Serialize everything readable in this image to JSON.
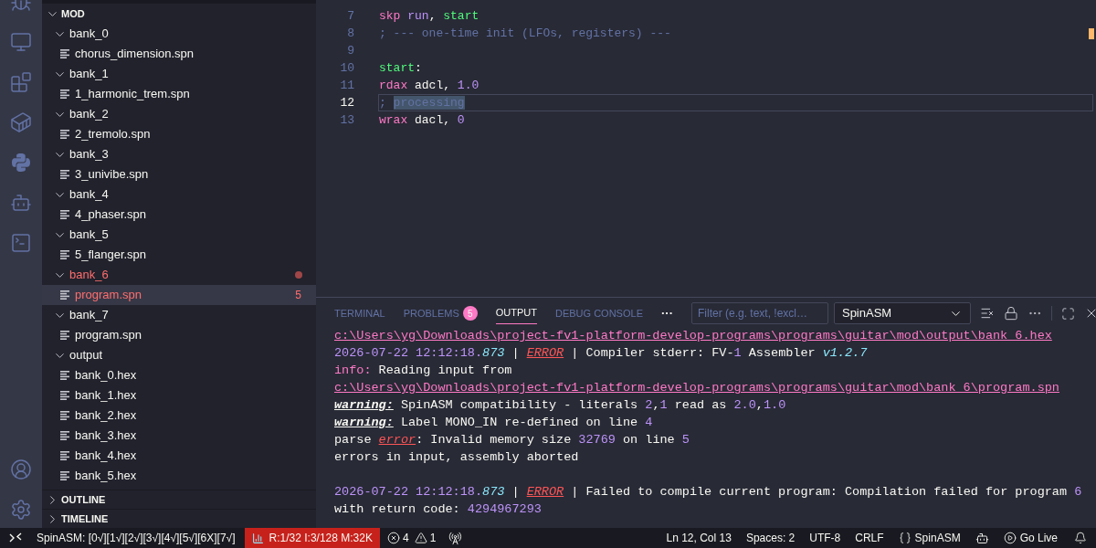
{
  "explorer": {
    "section": "MOD",
    "tree": [
      {
        "label": "bank_0",
        "expanded": true,
        "error": false,
        "selected": false,
        "children": [
          {
            "label": "chorus_dimension.spn",
            "error": false,
            "selected": false
          }
        ]
      },
      {
        "label": "bank_1",
        "expanded": true,
        "error": false,
        "selected": false,
        "children": [
          {
            "label": "1_harmonic_trem.spn",
            "error": false,
            "selected": false
          }
        ]
      },
      {
        "label": "bank_2",
        "expanded": true,
        "error": false,
        "selected": false,
        "children": [
          {
            "label": "2_tremolo.spn",
            "error": false,
            "selected": false
          }
        ]
      },
      {
        "label": "bank_3",
        "expanded": true,
        "error": false,
        "selected": false,
        "children": [
          {
            "label": "3_univibe.spn",
            "error": false,
            "selected": false
          }
        ]
      },
      {
        "label": "bank_4",
        "expanded": true,
        "error": false,
        "selected": false,
        "children": [
          {
            "label": "4_phaser.spn",
            "error": false,
            "selected": false
          }
        ]
      },
      {
        "label": "bank_5",
        "expanded": true,
        "error": false,
        "selected": false,
        "children": [
          {
            "label": "5_flanger.spn",
            "error": false,
            "selected": false
          }
        ]
      },
      {
        "label": "bank_6",
        "expanded": true,
        "error": true,
        "selected": false,
        "children": [
          {
            "label": "program.spn",
            "error": true,
            "selected": true,
            "badge": "5"
          }
        ]
      },
      {
        "label": "bank_7",
        "expanded": true,
        "error": false,
        "selected": false,
        "children": [
          {
            "label": "program.spn",
            "error": false,
            "selected": false
          }
        ]
      },
      {
        "label": "output",
        "expanded": true,
        "error": false,
        "selected": false,
        "children": [
          {
            "label": "bank_0.hex",
            "error": false,
            "selected": false
          },
          {
            "label": "bank_1.hex",
            "error": false,
            "selected": false
          },
          {
            "label": "bank_2.hex",
            "error": false,
            "selected": false
          },
          {
            "label": "bank_3.hex",
            "error": false,
            "selected": false
          },
          {
            "label": "bank_4.hex",
            "error": false,
            "selected": false
          },
          {
            "label": "bank_5.hex",
            "error": false,
            "selected": false
          }
        ]
      }
    ],
    "collapsed_sections": [
      "OUTLINE",
      "TIMELINE"
    ]
  },
  "editor": {
    "lines": [
      {
        "number": "7",
        "current": false,
        "tokens": [
          {
            "text": "skp",
            "kind": "keyword",
            "selected": false
          },
          {
            "text": " run",
            "kind": "variable",
            "selected": false
          },
          {
            "text": ", ",
            "kind": "plain",
            "selected": false
          },
          {
            "text": "start",
            "kind": "label",
            "selected": false
          }
        ]
      },
      {
        "number": "8",
        "current": false,
        "tokens": [
          {
            "text": "; --- one-time init (LFOs, registers) ---",
            "kind": "comment",
            "selected": false
          }
        ]
      },
      {
        "number": "9",
        "current": false
      },
      {
        "number": "10",
        "current": false,
        "tokens": [
          {
            "text": "start",
            "kind": "label",
            "selected": false
          },
          {
            "text": ":",
            "kind": "plain",
            "selected": false
          }
        ]
      },
      {
        "number": "11",
        "current": false,
        "tokens": [
          {
            "text": "rdax",
            "kind": "keyword",
            "selected": false
          },
          {
            "text": " adcl, ",
            "kind": "plain",
            "selected": false
          },
          {
            "text": "1.0",
            "kind": "number",
            "selected": false
          }
        ]
      },
      {
        "number": "12",
        "current": true,
        "tokens": [
          {
            "text": "; ",
            "kind": "comment",
            "selected": false
          },
          {
            "text": "processing",
            "kind": "comment",
            "selected": true
          }
        ]
      },
      {
        "number": "13",
        "current": false,
        "tokens": [
          {
            "text": "wrax",
            "kind": "keyword",
            "selected": false
          },
          {
            "text": " dacl, ",
            "kind": "plain",
            "selected": false
          },
          {
            "text": "0",
            "kind": "number",
            "selected": false
          }
        ]
      }
    ]
  },
  "panel": {
    "tabs": [
      {
        "label": "TERMINAL",
        "selected": false
      },
      {
        "label": "PROBLEMS",
        "badge": "5",
        "selected": false
      },
      {
        "label": "OUTPUT",
        "selected": true
      },
      {
        "label": "DEBUG CONSOLE",
        "selected": false
      }
    ],
    "more": "···",
    "filter": {
      "placeholder": "Filter (e.g. text, !excl…"
    },
    "channel": "SpinASM",
    "output": [
      {
        "space_before": false,
        "segments": [
          {
            "text": "c:\\Users\\yg\\Downloads\\project-fv1-platform-develop-programs\\programs\\guitar\\mod\\output\\bank_6.hex",
            "kind": "path"
          }
        ]
      },
      {
        "space_before": false,
        "segments": [
          {
            "text": "2026-07-22 12:12:18.",
            "kind": "timestamp"
          },
          {
            "text": "873",
            "kind": "ms"
          },
          {
            "text": " | ",
            "kind": "text"
          },
          {
            "text": "ERROR",
            "kind": "error_tag"
          },
          {
            "text": " | Compiler stderr: FV-",
            "kind": "text"
          },
          {
            "text": "1",
            "kind": "number"
          },
          {
            "text": " Assembler ",
            "kind": "text"
          },
          {
            "text": "v1.2.7",
            "kind": "ms"
          }
        ]
      },
      {
        "space_before": false,
        "segments": [
          {
            "text": "info:",
            "kind": "info"
          },
          {
            "text": " Reading input from",
            "kind": "text"
          }
        ]
      },
      {
        "space_before": false,
        "segments": [
          {
            "text": "c:\\Users\\yg\\Downloads\\project-fv1-platform-develop-programs\\programs\\guitar\\mod\\bank_6\\program.spn",
            "kind": "path"
          }
        ]
      },
      {
        "space_before": false,
        "segments": [
          {
            "text": "warning:",
            "kind": "warning"
          },
          {
            "text": " SpinASM compatibility - literals ",
            "kind": "text"
          },
          {
            "text": "2",
            "kind": "number"
          },
          {
            "text": ",",
            "kind": "text"
          },
          {
            "text": "1",
            "kind": "number"
          },
          {
            "text": " read as ",
            "kind": "text"
          },
          {
            "text": "2.0",
            "kind": "number"
          },
          {
            "text": ",",
            "kind": "text"
          },
          {
            "text": "1.0",
            "kind": "number"
          }
        ]
      },
      {
        "space_before": false,
        "segments": [
          {
            "text": "warning:",
            "kind": "warning"
          },
          {
            "text": " Label MONO_IN re-defined on line ",
            "kind": "text"
          },
          {
            "text": "4",
            "kind": "number"
          }
        ]
      },
      {
        "space_before": false,
        "segments": [
          {
            "text": "parse ",
            "kind": "text"
          },
          {
            "text": "error",
            "kind": "error_tag"
          },
          {
            "text": ": Invalid memory size ",
            "kind": "text"
          },
          {
            "text": "32769",
            "kind": "number"
          },
          {
            "text": " on line ",
            "kind": "text"
          },
          {
            "text": "5",
            "kind": "number"
          }
        ]
      },
      {
        "space_before": false,
        "segments": [
          {
            "text": "errors in input, assembly aborted",
            "kind": "text"
          }
        ]
      },
      {
        "space_before": true,
        "segments": [
          {
            "text": "2026-07-22 12:12:18.",
            "kind": "timestamp"
          },
          {
            "text": "873",
            "kind": "ms"
          },
          {
            "text": " | ",
            "kind": "text"
          },
          {
            "text": "ERROR",
            "kind": "error_tag"
          },
          {
            "text": " | Failed to compile current program: Compilation failed for program ",
            "kind": "text"
          },
          {
            "text": "6",
            "kind": "number"
          }
        ]
      },
      {
        "space_before": false,
        "segments": [
          {
            "text": "with return code: ",
            "kind": "text"
          },
          {
            "text": "4294967293",
            "kind": "number"
          }
        ]
      }
    ]
  },
  "status_bar": {
    "build": "SpinASM: [0√][1√][2√][3√][4√][5√][6X][7√]",
    "resources": {
      "text": "R:1/32 I:3/128 M:32K",
      "alert": true
    },
    "errors": "4",
    "warnings": "1",
    "position": "Ln 12, Col 13",
    "indent": "Spaces: 2",
    "encoding": "UTF-8",
    "eol": "CRLF",
    "language": "SpinASM",
    "live": "Go Live"
  }
}
